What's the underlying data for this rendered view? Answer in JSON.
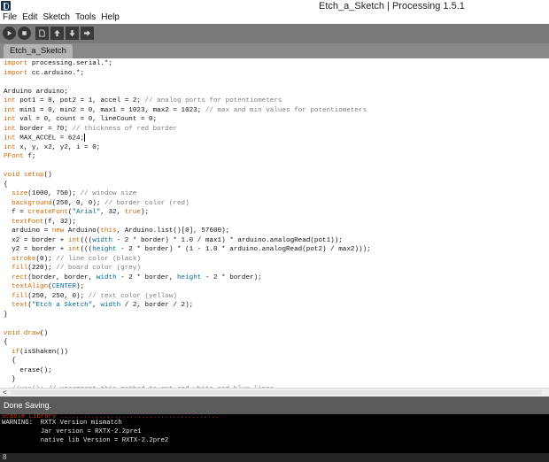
{
  "window": {
    "title": "Etch_a_Sketch | Processing 1.5.1",
    "icon": "processing-app-icon"
  },
  "menu": {
    "items": [
      "File",
      "Edit",
      "Sketch",
      "Tools",
      "Help"
    ]
  },
  "toolbar": {
    "buttons": [
      {
        "name": "run-button",
        "icon": "play-icon"
      },
      {
        "name": "stop-button",
        "icon": "stop-icon"
      },
      {
        "name": "new-button",
        "icon": "new-file-icon"
      },
      {
        "name": "open-button",
        "icon": "open-up-arrow-icon"
      },
      {
        "name": "save-button",
        "icon": "save-down-arrow-icon"
      },
      {
        "name": "export-button",
        "icon": "export-icon"
      }
    ]
  },
  "tabs": [
    {
      "label": "Etch_a_Sketch",
      "active": true
    }
  ],
  "editor": {
    "caret_line": 10,
    "lines": [
      [
        {
          "t": "import",
          "c": "#cc6600"
        },
        {
          "t": " processing.serial.*;",
          "c": "#111111"
        }
      ],
      [
        {
          "t": "import",
          "c": "#cc6600"
        },
        {
          "t": " cc.arduino.*;",
          "c": "#111111"
        }
      ],
      [],
      [
        {
          "t": "Arduino arduino;",
          "c": "#111111"
        }
      ],
      [
        {
          "t": "int",
          "c": "#cc6600"
        },
        {
          "t": " pot1 = 0, pot2 = 1, accel = 2; ",
          "c": "#111111"
        },
        {
          "t": "// analog ports for potentiometers",
          "c": "#7e7e7e"
        }
      ],
      [
        {
          "t": "int",
          "c": "#cc6600"
        },
        {
          "t": " min1 = 0, min2 = 0, max1 = 1023, max2 = 1023; ",
          "c": "#111111"
        },
        {
          "t": "// max and min values for potentiometers",
          "c": "#7e7e7e"
        }
      ],
      [
        {
          "t": "int",
          "c": "#cc6600"
        },
        {
          "t": " val = 0, count = 0, lineCount = 0;",
          "c": "#111111"
        }
      ],
      [
        {
          "t": "int",
          "c": "#cc6600"
        },
        {
          "t": " border = 70; ",
          "c": "#111111"
        },
        {
          "t": "// thickness of red border",
          "c": "#7e7e7e"
        }
      ],
      [
        {
          "t": "int",
          "c": "#cc6600"
        },
        {
          "t": " MAX_ACCEL = 624;",
          "c": "#111111"
        }
      ],
      [
        {
          "t": "int",
          "c": "#cc6600"
        },
        {
          "t": " x, y, x2, y2, i = 0;",
          "c": "#111111"
        }
      ],
      [
        {
          "t": "PFont",
          "c": "#cc6600"
        },
        {
          "t": " f;",
          "c": "#111111"
        }
      ],
      [],
      [
        {
          "t": "void",
          "c": "#cc6600"
        },
        {
          "t": " ",
          "c": "#111111"
        },
        {
          "t": "setup",
          "c": "#cc6600"
        },
        {
          "t": "()",
          "c": "#111111"
        }
      ],
      [
        {
          "t": "{",
          "c": "#111111"
        }
      ],
      [
        {
          "t": "  ",
          "c": "#111111"
        },
        {
          "t": "size",
          "c": "#cc6600"
        },
        {
          "t": "(1000, 750); ",
          "c": "#111111"
        },
        {
          "t": "// window size",
          "c": "#7e7e7e"
        }
      ],
      [
        {
          "t": "  ",
          "c": "#111111"
        },
        {
          "t": "background",
          "c": "#cc6600"
        },
        {
          "t": "(250, 0, 0); ",
          "c": "#111111"
        },
        {
          "t": "// border color (red)",
          "c": "#7e7e7e"
        }
      ],
      [
        {
          "t": "  f = ",
          "c": "#111111"
        },
        {
          "t": "createFont",
          "c": "#cc6600"
        },
        {
          "t": "(",
          "c": "#111111"
        },
        {
          "t": "\"Arial\"",
          "c": "#006699"
        },
        {
          "t": ", 32, ",
          "c": "#111111"
        },
        {
          "t": "true",
          "c": "#cc6600"
        },
        {
          "t": ");",
          "c": "#111111"
        }
      ],
      [
        {
          "t": "  ",
          "c": "#111111"
        },
        {
          "t": "textFont",
          "c": "#cc6600"
        },
        {
          "t": "(f, 32);",
          "c": "#111111"
        }
      ],
      [
        {
          "t": "  arduino = ",
          "c": "#111111"
        },
        {
          "t": "new",
          "c": "#cc6600"
        },
        {
          "t": " Arduino(",
          "c": "#111111"
        },
        {
          "t": "this",
          "c": "#cc6600"
        },
        {
          "t": ", Arduino.list()[0], 57600);",
          "c": "#111111"
        }
      ],
      [
        {
          "t": "  x2 = border + ",
          "c": "#111111"
        },
        {
          "t": "int",
          "c": "#cc6600"
        },
        {
          "t": "(((",
          "c": "#111111"
        },
        {
          "t": "width",
          "c": "#006699"
        },
        {
          "t": " - 2 * border) * 1.0 / max1) * arduino.analogRead(pot1));",
          "c": "#111111"
        }
      ],
      [
        {
          "t": "  y2 = border + ",
          "c": "#111111"
        },
        {
          "t": "int",
          "c": "#cc6600"
        },
        {
          "t": "(((",
          "c": "#111111"
        },
        {
          "t": "height",
          "c": "#006699"
        },
        {
          "t": " - 2 * border) * (1 - 1.0 * arduino.analogRead(pot2) / max2)));",
          "c": "#111111"
        }
      ],
      [
        {
          "t": "  ",
          "c": "#111111"
        },
        {
          "t": "stroke",
          "c": "#cc6600"
        },
        {
          "t": "(0); ",
          "c": "#111111"
        },
        {
          "t": "// line color (black)",
          "c": "#7e7e7e"
        }
      ],
      [
        {
          "t": "  ",
          "c": "#111111"
        },
        {
          "t": "fill",
          "c": "#cc6600"
        },
        {
          "t": "(220); ",
          "c": "#111111"
        },
        {
          "t": "// board color (grey)",
          "c": "#7e7e7e"
        }
      ],
      [
        {
          "t": "  ",
          "c": "#111111"
        },
        {
          "t": "rect",
          "c": "#cc6600"
        },
        {
          "t": "(border, border, ",
          "c": "#111111"
        },
        {
          "t": "width",
          "c": "#006699"
        },
        {
          "t": " - 2 * border, ",
          "c": "#111111"
        },
        {
          "t": "height",
          "c": "#006699"
        },
        {
          "t": " - 2 * border);",
          "c": "#111111"
        }
      ],
      [
        {
          "t": "  ",
          "c": "#111111"
        },
        {
          "t": "textAlign",
          "c": "#cc6600"
        },
        {
          "t": "(",
          "c": "#111111"
        },
        {
          "t": "CENTER",
          "c": "#006699"
        },
        {
          "t": ");",
          "c": "#111111"
        }
      ],
      [
        {
          "t": "  ",
          "c": "#111111"
        },
        {
          "t": "fill",
          "c": "#cc6600"
        },
        {
          "t": "(250, 250, 0); ",
          "c": "#111111"
        },
        {
          "t": "// text color (yellow)",
          "c": "#7e7e7e"
        }
      ],
      [
        {
          "t": "  ",
          "c": "#111111"
        },
        {
          "t": "text",
          "c": "#cc6600"
        },
        {
          "t": "(",
          "c": "#111111"
        },
        {
          "t": "\"Etch a Sketch\"",
          "c": "#006699"
        },
        {
          "t": ", ",
          "c": "#111111"
        },
        {
          "t": "width",
          "c": "#006699"
        },
        {
          "t": " / 2, border / 2);",
          "c": "#111111"
        }
      ],
      [
        {
          "t": "}",
          "c": "#111111"
        }
      ],
      [],
      [
        {
          "t": "void",
          "c": "#cc6600"
        },
        {
          "t": " ",
          "c": "#111111"
        },
        {
          "t": "draw",
          "c": "#cc6600"
        },
        {
          "t": "()",
          "c": "#111111"
        }
      ],
      [
        {
          "t": "{",
          "c": "#111111"
        }
      ],
      [
        {
          "t": "  ",
          "c": "#111111"
        },
        {
          "t": "if",
          "c": "#cc6600"
        },
        {
          "t": "(isShaken())",
          "c": "#111111"
        }
      ],
      [
        {
          "t": "  {",
          "c": "#111111"
        }
      ],
      [
        {
          "t": "    erase();",
          "c": "#111111"
        }
      ],
      [
        {
          "t": "  }",
          "c": "#111111"
        }
      ],
      [
        {
          "t": "  ",
          "c": "#111111"
        },
        {
          "t": "//usa(); // uncomment this method to get red white and blue lines",
          "c": "#7e7e7e"
        }
      ]
    ]
  },
  "status": {
    "message": "Done Saving."
  },
  "console": {
    "lines": [
      {
        "text": "Stable Library .........................................",
        "kind": "err"
      },
      {
        "text": "WARNING:  RXTX Version mismatch",
        "kind": "normal"
      },
      {
        "text": "          Jar version = RXTX-2.2pre1",
        "kind": "normal"
      },
      {
        "text": "          native lib Version = RXTX-2.2pre2",
        "kind": "normal"
      }
    ]
  },
  "footer": {
    "line_number": "8"
  },
  "colors": {
    "keyword": "#cc6600",
    "constant": "#006699",
    "comment": "#7e7e7e",
    "toolbar": "#7a7a7a",
    "status": "#5a5a5a",
    "console_bg": "#000000",
    "console_error": "#c53b1c"
  }
}
